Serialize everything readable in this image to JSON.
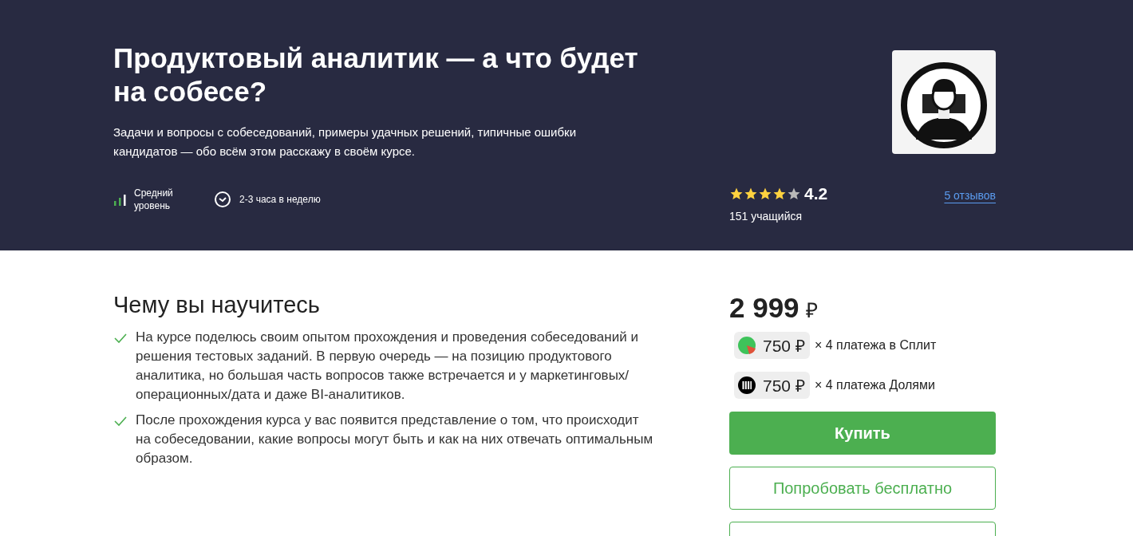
{
  "header": {
    "title": "Продуктовый аналитик — а что будет на собесе?",
    "description": "Задачи и вопросы с собеседований, примеры удачных решений, типичные ошибки кандидатов — обо всём этом расскажу в своём курсе.",
    "level": {
      "label": "Средний уровень"
    },
    "duration": "2-3 часа в неделю",
    "rating": {
      "stars": 4,
      "value": "4.2",
      "learners": "151 учащийся",
      "reviews": "5 отзывов"
    }
  },
  "learn": {
    "title": "Чему вы научитесь",
    "items": [
      "На курсе поделюсь своим опытом прохождения и проведения собеседований и решения тестовых заданий. В первую очередь — на позицию продуктового аналитика, но большая часть вопросов также встречается и у маркетинговых/операционных/дата и даже BI-аналитиков.",
      "После прохождения курса у вас появится представление о том, что происходит на собеседовании, какие вопросы могут быть и как на них отвечать оптимальным образом."
    ]
  },
  "price": {
    "amount": "2 999",
    "currency": "₽",
    "installments": [
      {
        "kind": "split",
        "amount": "750",
        "currency": "₽",
        "text": "× 4 платежа в Сплит"
      },
      {
        "kind": "dolyami",
        "amount": "750",
        "currency": "₽",
        "text": "× 4 платежа Долями"
      }
    ],
    "buttons": [
      {
        "kind": "primary",
        "label": "Купить"
      },
      {
        "kind": "outline",
        "label": "Попробовать бесплатно"
      },
      {
        "kind": "outline"
      }
    ]
  }
}
